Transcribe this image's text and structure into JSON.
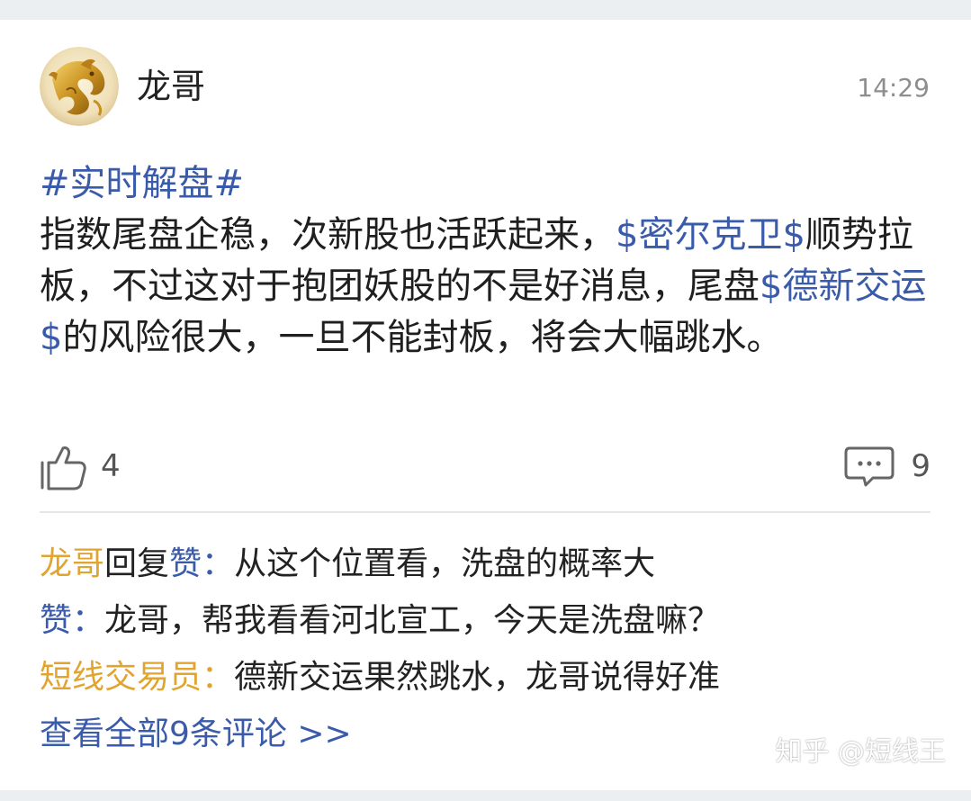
{
  "post": {
    "author": "龙哥",
    "time": "14:29",
    "topic": "#实时解盘#",
    "text_1": "指数尾盘企稳，次新股也活跃起来，",
    "stock_1": "$密尔克卫$",
    "text_2": "顺势拉板，不过这对于抱团妖股的不是好消息，尾盘",
    "stock_2": "$德新交运$",
    "text_3": "的风险很大，一旦不能封板，将会大幅跳水。",
    "likes": "4",
    "comments": "9",
    "avatar_icon": "golden-dragon-avatar",
    "like_icon": "thumbs-up-icon",
    "comment_icon": "speech-bubble-icon"
  },
  "comments": [
    {
      "name": "龙哥",
      "reply_word": "回复",
      "reply_to": "赞",
      "colon": "：",
      "text": "从这个位置看，洗盘的概率大"
    },
    {
      "name": "赞",
      "colon": "：",
      "text": "龙哥，帮我看看河北宣工，今天是洗盘嘛？"
    },
    {
      "name": "短线交易员",
      "colon": "：",
      "text": "德新交运果然跳水，龙哥说得好准"
    }
  ],
  "view_all": "查看全部9条评论 >>",
  "watermark": "知乎 @短线王",
  "colors": {
    "link_blue": "#3a5ba9",
    "name_orange": "#e0a431",
    "text": "#1f1f1f",
    "muted": "#8e8e8e",
    "background": "#eceff1"
  }
}
